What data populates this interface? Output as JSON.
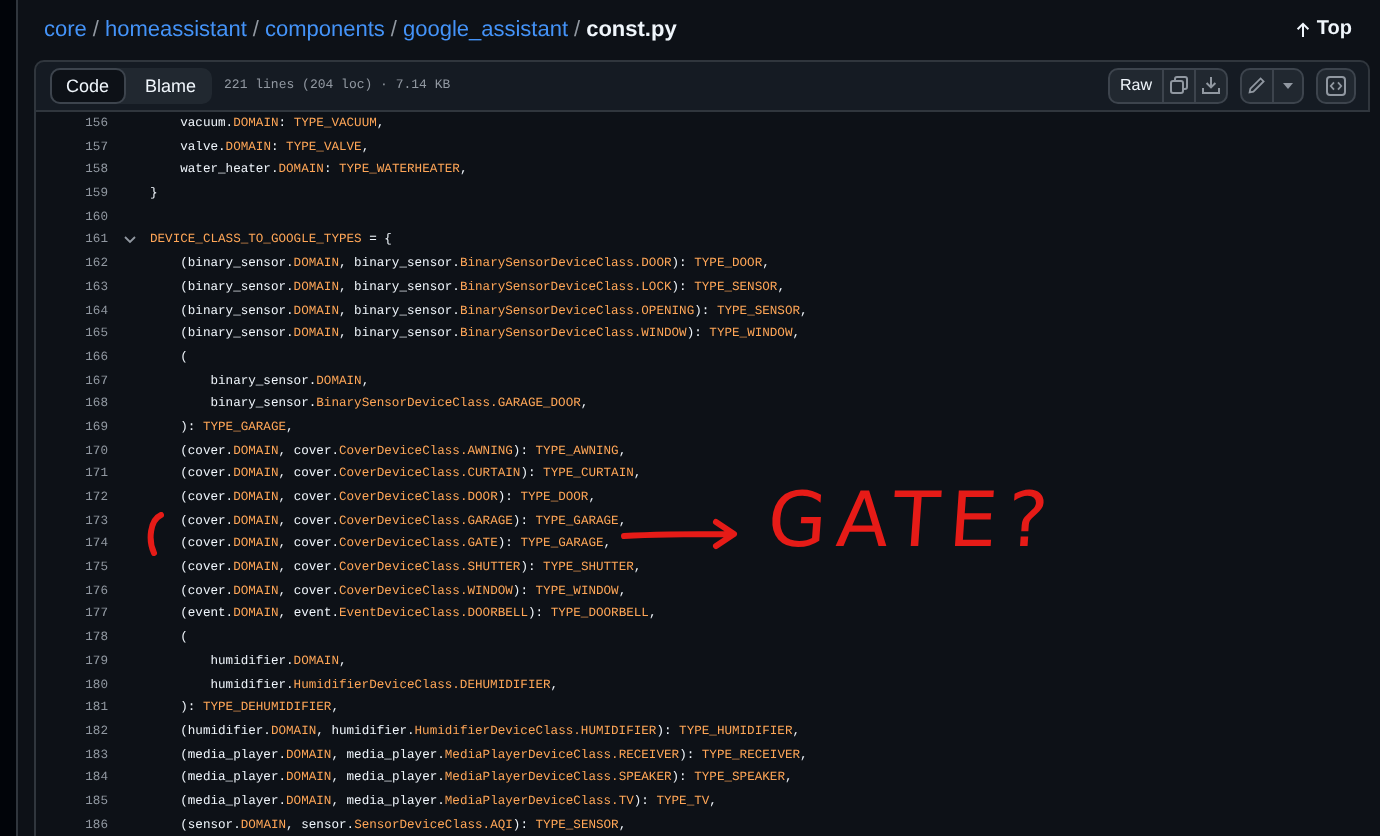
{
  "breadcrumb": {
    "path": [
      {
        "label": "core",
        "sep": "/"
      },
      {
        "label": "homeassistant",
        "sep": "/"
      },
      {
        "label": "components",
        "sep": "/"
      },
      {
        "label": "google_assistant",
        "sep": "/"
      }
    ],
    "file": "const.py"
  },
  "top_link": {
    "label": "Top"
  },
  "tabs": [
    {
      "label": "Code",
      "selected": true
    },
    {
      "label": "Blame",
      "selected": false
    }
  ],
  "file_info": "221 lines (204 loc) · 7.14 KB",
  "raw_button": {
    "label": "Raw"
  },
  "code_lines": [
    {
      "number": "156",
      "segments": [
        {
          "text": "    vacuum.",
          "kind": "plain"
        },
        {
          "text": "DOMAIN",
          "kind": "const"
        },
        {
          "text": ": ",
          "kind": "plain"
        },
        {
          "text": "TYPE_VACUUM",
          "kind": "const"
        },
        {
          "text": ",",
          "kind": "plain"
        }
      ]
    },
    {
      "number": "157",
      "segments": [
        {
          "text": "    valve.",
          "kind": "plain"
        },
        {
          "text": "DOMAIN",
          "kind": "const"
        },
        {
          "text": ": ",
          "kind": "plain"
        },
        {
          "text": "TYPE_VALVE",
          "kind": "const"
        },
        {
          "text": ",",
          "kind": "plain"
        }
      ]
    },
    {
      "number": "158",
      "segments": [
        {
          "text": "    water_heater.",
          "kind": "plain"
        },
        {
          "text": "DOMAIN",
          "kind": "const"
        },
        {
          "text": ": ",
          "kind": "plain"
        },
        {
          "text": "TYPE_WATERHEATER",
          "kind": "const"
        },
        {
          "text": ",",
          "kind": "plain"
        }
      ]
    },
    {
      "number": "159",
      "segments": [
        {
          "text": "}",
          "kind": "plain"
        }
      ]
    },
    {
      "number": "160"
    },
    {
      "number": "161",
      "expanded": true,
      "segments": [
        {
          "text": "DEVICE_CLASS_TO_GOOGLE_TYPES",
          "kind": "const"
        },
        {
          "text": " = {",
          "kind": "plain"
        }
      ]
    },
    {
      "number": "162",
      "segments": [
        {
          "text": "    (binary_sensor.",
          "kind": "plain"
        },
        {
          "text": "DOMAIN",
          "kind": "const"
        },
        {
          "text": ", binary_sensor.",
          "kind": "plain"
        },
        {
          "text": "BinarySensorDeviceClass.DOOR",
          "kind": "const"
        },
        {
          "text": "): ",
          "kind": "plain"
        },
        {
          "text": "TYPE_DOOR",
          "kind": "const"
        },
        {
          "text": ",",
          "kind": "plain"
        }
      ]
    },
    {
      "number": "163",
      "segments": [
        {
          "text": "    (binary_sensor.",
          "kind": "plain"
        },
        {
          "text": "DOMAIN",
          "kind": "const"
        },
        {
          "text": ", binary_sensor.",
          "kind": "plain"
        },
        {
          "text": "BinarySensorDeviceClass.LOCK",
          "kind": "const"
        },
        {
          "text": "): ",
          "kind": "plain"
        },
        {
          "text": "TYPE_SENSOR",
          "kind": "const"
        },
        {
          "text": ",",
          "kind": "plain"
        }
      ]
    },
    {
      "number": "164",
      "segments": [
        {
          "text": "    (binary_sensor.",
          "kind": "plain"
        },
        {
          "text": "DOMAIN",
          "kind": "const"
        },
        {
          "text": ", binary_sensor.",
          "kind": "plain"
        },
        {
          "text": "BinarySensorDeviceClass.OPENING",
          "kind": "const"
        },
        {
          "text": "): ",
          "kind": "plain"
        },
        {
          "text": "TYPE_SENSOR",
          "kind": "const"
        },
        {
          "text": ",",
          "kind": "plain"
        }
      ]
    },
    {
      "number": "165",
      "segments": [
        {
          "text": "    (binary_sensor.",
          "kind": "plain"
        },
        {
          "text": "DOMAIN",
          "kind": "const"
        },
        {
          "text": ", binary_sensor.",
          "kind": "plain"
        },
        {
          "text": "BinarySensorDeviceClass.WINDOW",
          "kind": "const"
        },
        {
          "text": "): ",
          "kind": "plain"
        },
        {
          "text": "TYPE_WINDOW",
          "kind": "const"
        },
        {
          "text": ",",
          "kind": "plain"
        }
      ]
    },
    {
      "number": "166",
      "segments": [
        {
          "text": "    (",
          "kind": "plain"
        }
      ]
    },
    {
      "number": "167",
      "segments": [
        {
          "text": "        binary_sensor.",
          "kind": "plain"
        },
        {
          "text": "DOMAIN",
          "kind": "const"
        },
        {
          "text": ",",
          "kind": "plain"
        }
      ]
    },
    {
      "number": "168",
      "segments": [
        {
          "text": "        binary_sensor.",
          "kind": "plain"
        },
        {
          "text": "BinarySensorDeviceClass.GARAGE_DOOR",
          "kind": "const"
        },
        {
          "text": ",",
          "kind": "plain"
        }
      ]
    },
    {
      "number": "169",
      "segments": [
        {
          "text": "    ): ",
          "kind": "plain"
        },
        {
          "text": "TYPE_GARAGE",
          "kind": "const"
        },
        {
          "text": ",",
          "kind": "plain"
        }
      ]
    },
    {
      "number": "170",
      "segments": [
        {
          "text": "    (cover.",
          "kind": "plain"
        },
        {
          "text": "DOMAIN",
          "kind": "const"
        },
        {
          "text": ", cover.",
          "kind": "plain"
        },
        {
          "text": "CoverDeviceClass.AWNING",
          "kind": "const"
        },
        {
          "text": "): ",
          "kind": "plain"
        },
        {
          "text": "TYPE_AWNING",
          "kind": "const"
        },
        {
          "text": ",",
          "kind": "plain"
        }
      ]
    },
    {
      "number": "171",
      "segments": [
        {
          "text": "    (cover.",
          "kind": "plain"
        },
        {
          "text": "DOMAIN",
          "kind": "const"
        },
        {
          "text": ", cover.",
          "kind": "plain"
        },
        {
          "text": "CoverDeviceClass.CURTAIN",
          "kind": "const"
        },
        {
          "text": "): ",
          "kind": "plain"
        },
        {
          "text": "TYPE_CURTAIN",
          "kind": "const"
        },
        {
          "text": ",",
          "kind": "plain"
        }
      ]
    },
    {
      "number": "172",
      "segments": [
        {
          "text": "    (cover.",
          "kind": "plain"
        },
        {
          "text": "DOMAIN",
          "kind": "const"
        },
        {
          "text": ", cover.",
          "kind": "plain"
        },
        {
          "text": "CoverDeviceClass.DOOR",
          "kind": "const"
        },
        {
          "text": "): ",
          "kind": "plain"
        },
        {
          "text": "TYPE_DOOR",
          "kind": "const"
        },
        {
          "text": ",",
          "kind": "plain"
        }
      ]
    },
    {
      "number": "173",
      "segments": [
        {
          "text": "    (cover.",
          "kind": "plain"
        },
        {
          "text": "DOMAIN",
          "kind": "const"
        },
        {
          "text": ", cover.",
          "kind": "plain"
        },
        {
          "text": "CoverDeviceClass.GARAGE",
          "kind": "const"
        },
        {
          "text": "): ",
          "kind": "plain"
        },
        {
          "text": "TYPE_GARAGE",
          "kind": "const"
        },
        {
          "text": ",",
          "kind": "plain"
        }
      ]
    },
    {
      "number": "174",
      "segments": [
        {
          "text": "    (cover.",
          "kind": "plain"
        },
        {
          "text": "DOMAIN",
          "kind": "const"
        },
        {
          "text": ", cover.",
          "kind": "plain"
        },
        {
          "text": "CoverDeviceClass.GATE",
          "kind": "const"
        },
        {
          "text": "): ",
          "kind": "plain"
        },
        {
          "text": "TYPE_GARAGE",
          "kind": "const"
        },
        {
          "text": ",",
          "kind": "plain"
        }
      ]
    },
    {
      "number": "175",
      "segments": [
        {
          "text": "    (cover.",
          "kind": "plain"
        },
        {
          "text": "DOMAIN",
          "kind": "const"
        },
        {
          "text": ", cover.",
          "kind": "plain"
        },
        {
          "text": "CoverDeviceClass.SHUTTER",
          "kind": "const"
        },
        {
          "text": "): ",
          "kind": "plain"
        },
        {
          "text": "TYPE_SHUTTER",
          "kind": "const"
        },
        {
          "text": ",",
          "kind": "plain"
        }
      ]
    },
    {
      "number": "176",
      "segments": [
        {
          "text": "    (cover.",
          "kind": "plain"
        },
        {
          "text": "DOMAIN",
          "kind": "const"
        },
        {
          "text": ", cover.",
          "kind": "plain"
        },
        {
          "text": "CoverDeviceClass.WINDOW",
          "kind": "const"
        },
        {
          "text": "): ",
          "kind": "plain"
        },
        {
          "text": "TYPE_WINDOW",
          "kind": "const"
        },
        {
          "text": ",",
          "kind": "plain"
        }
      ]
    },
    {
      "number": "177",
      "segments": [
        {
          "text": "    (event.",
          "kind": "plain"
        },
        {
          "text": "DOMAIN",
          "kind": "const"
        },
        {
          "text": ", event.",
          "kind": "plain"
        },
        {
          "text": "EventDeviceClass.DOORBELL",
          "kind": "const"
        },
        {
          "text": "): ",
          "kind": "plain"
        },
        {
          "text": "TYPE_DOORBELL",
          "kind": "const"
        },
        {
          "text": ",",
          "kind": "plain"
        }
      ]
    },
    {
      "number": "178",
      "segments": [
        {
          "text": "    (",
          "kind": "plain"
        }
      ]
    },
    {
      "number": "179",
      "segments": [
        {
          "text": "        humidifier.",
          "kind": "plain"
        },
        {
          "text": "DOMAIN",
          "kind": "const"
        },
        {
          "text": ",",
          "kind": "plain"
        }
      ]
    },
    {
      "number": "180",
      "segments": [
        {
          "text": "        humidifier.",
          "kind": "plain"
        },
        {
          "text": "HumidifierDeviceClass.DEHUMIDIFIER",
          "kind": "const"
        },
        {
          "text": ",",
          "kind": "plain"
        }
      ]
    },
    {
      "number": "181",
      "segments": [
        {
          "text": "    ): ",
          "kind": "plain"
        },
        {
          "text": "TYPE_DEHUMIDIFIER",
          "kind": "const"
        },
        {
          "text": ",",
          "kind": "plain"
        }
      ]
    },
    {
      "number": "182",
      "segments": [
        {
          "text": "    (humidifier.",
          "kind": "plain"
        },
        {
          "text": "DOMAIN",
          "kind": "const"
        },
        {
          "text": ", humidifier.",
          "kind": "plain"
        },
        {
          "text": "HumidifierDeviceClass.HUMIDIFIER",
          "kind": "const"
        },
        {
          "text": "): ",
          "kind": "plain"
        },
        {
          "text": "TYPE_HUMIDIFIER",
          "kind": "const"
        },
        {
          "text": ",",
          "kind": "plain"
        }
      ]
    },
    {
      "number": "183",
      "segments": [
        {
          "text": "    (media_player.",
          "kind": "plain"
        },
        {
          "text": "DOMAIN",
          "kind": "const"
        },
        {
          "text": ", media_player.",
          "kind": "plain"
        },
        {
          "text": "MediaPlayerDeviceClass.RECEIVER",
          "kind": "const"
        },
        {
          "text": "): ",
          "kind": "plain"
        },
        {
          "text": "TYPE_RECEIVER",
          "kind": "const"
        },
        {
          "text": ",",
          "kind": "plain"
        }
      ]
    },
    {
      "number": "184",
      "segments": [
        {
          "text": "    (media_player.",
          "kind": "plain"
        },
        {
          "text": "DOMAIN",
          "kind": "const"
        },
        {
          "text": ", media_player.",
          "kind": "plain"
        },
        {
          "text": "MediaPlayerDeviceClass.SPEAKER",
          "kind": "const"
        },
        {
          "text": "): ",
          "kind": "plain"
        },
        {
          "text": "TYPE_SPEAKER",
          "kind": "const"
        },
        {
          "text": ",",
          "kind": "plain"
        }
      ]
    },
    {
      "number": "185",
      "segments": [
        {
          "text": "    (media_player.",
          "kind": "plain"
        },
        {
          "text": "DOMAIN",
          "kind": "const"
        },
        {
          "text": ", media_player.",
          "kind": "plain"
        },
        {
          "text": "MediaPlayerDeviceClass.TV",
          "kind": "const"
        },
        {
          "text": "): ",
          "kind": "plain"
        },
        {
          "text": "TYPE_TV",
          "kind": "const"
        },
        {
          "text": ",",
          "kind": "plain"
        }
      ]
    },
    {
      "number": "186",
      "segments": [
        {
          "text": "    (sensor.",
          "kind": "plain"
        },
        {
          "text": "DOMAIN",
          "kind": "const"
        },
        {
          "text": ", sensor.",
          "kind": "plain"
        },
        {
          "text": "SensorDeviceClass.AQI",
          "kind": "const"
        },
        {
          "text": "): ",
          "kind": "plain"
        },
        {
          "text": "TYPE_SENSOR",
          "kind": "const"
        },
        {
          "text": ",",
          "kind": "plain"
        }
      ]
    }
  ],
  "annotation": {
    "text": "GATE?"
  }
}
